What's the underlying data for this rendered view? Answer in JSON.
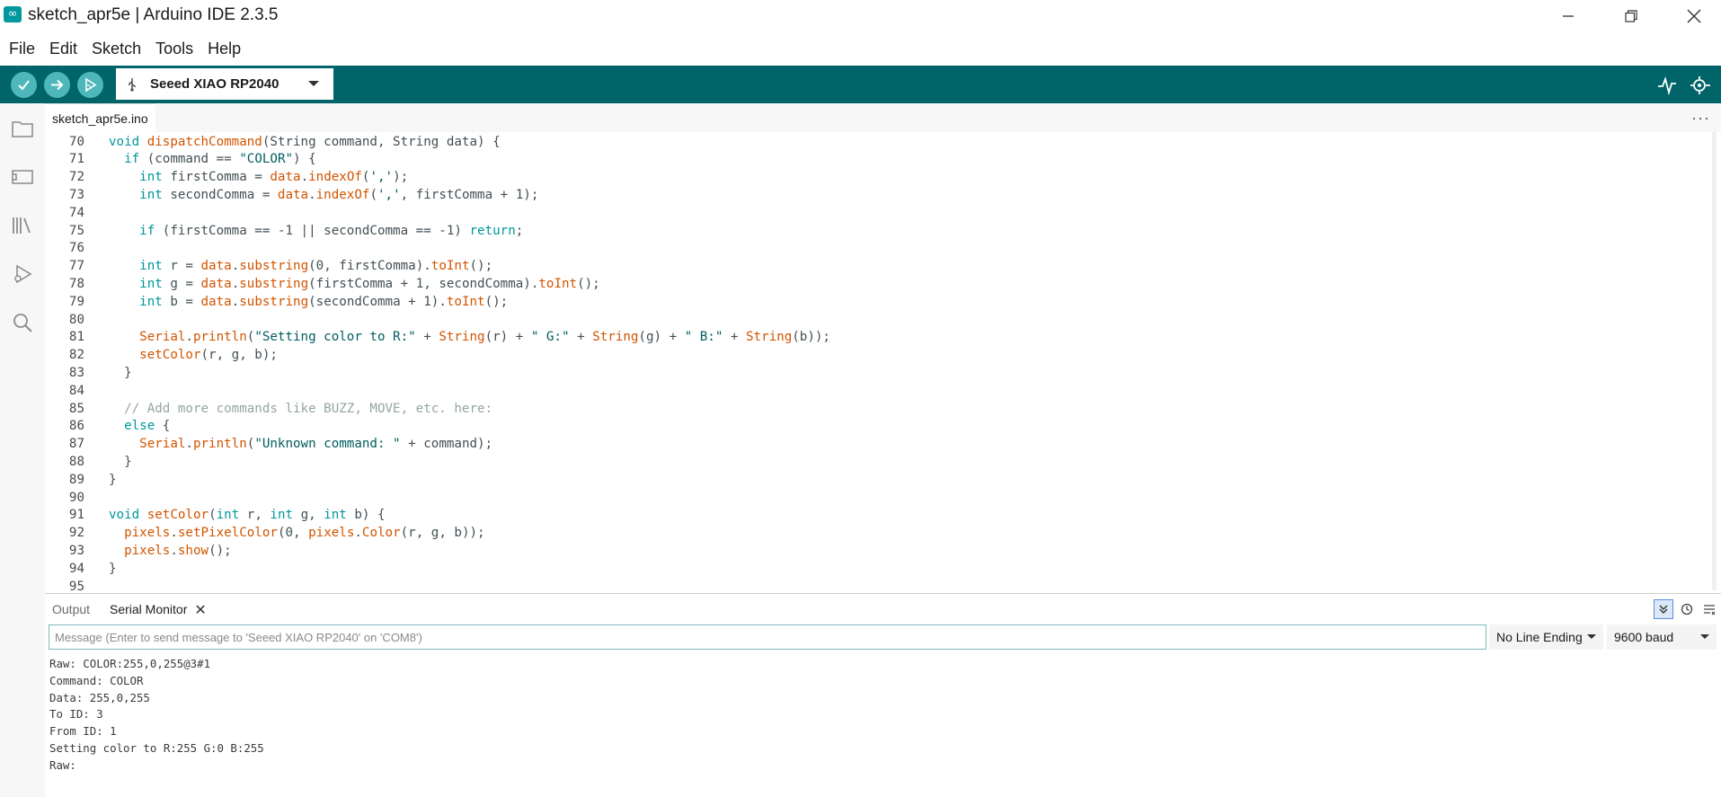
{
  "window": {
    "title": "sketch_apr5e | Arduino IDE 2.3.5",
    "minimize": "—",
    "maximize": "❐",
    "close": "✕"
  },
  "menu": [
    "File",
    "Edit",
    "Sketch",
    "Tools",
    "Help"
  ],
  "toolbar": {
    "board": "Seeed XIAO RP2040",
    "buttons": [
      "verify-icon",
      "upload-icon",
      "debug-icon"
    ],
    "right_icons": [
      "serial-plotter-icon",
      "serial-monitor-icon"
    ]
  },
  "activity": [
    "folder-icon",
    "boards-manager-icon",
    "library-manager-icon",
    "debug-icon",
    "search-icon"
  ],
  "editor": {
    "tab": "sketch_apr5e.ino",
    "more": "···",
    "lines": [
      {
        "n": "70",
        "segs": [
          [
            "kw",
            "void"
          ],
          [
            "",
            " "
          ],
          [
            "fn",
            "dispatchCommand"
          ],
          [
            "",
            "(String command, String data) {"
          ]
        ]
      },
      {
        "n": "71",
        "segs": [
          [
            "",
            "  "
          ],
          [
            "kw",
            "if"
          ],
          [
            "",
            " (command == "
          ],
          [
            "str",
            "\"COLOR\""
          ],
          [
            "",
            ") {"
          ]
        ]
      },
      {
        "n": "72",
        "segs": [
          [
            "",
            "    "
          ],
          [
            "kw",
            "int"
          ],
          [
            "",
            " firstComma = "
          ],
          [
            "fn",
            "data"
          ],
          [
            "",
            "."
          ],
          [
            "fn",
            "indexOf"
          ],
          [
            "",
            "("
          ],
          [
            "str",
            "','"
          ],
          [
            "",
            ");"
          ]
        ]
      },
      {
        "n": "73",
        "segs": [
          [
            "",
            "    "
          ],
          [
            "kw",
            "int"
          ],
          [
            "",
            " secondComma = "
          ],
          [
            "fn",
            "data"
          ],
          [
            "",
            "."
          ],
          [
            "fn",
            "indexOf"
          ],
          [
            "",
            "("
          ],
          [
            "str",
            "','"
          ],
          [
            "",
            ", firstComma + 1);"
          ]
        ]
      },
      {
        "n": "74",
        "segs": []
      },
      {
        "n": "75",
        "segs": [
          [
            "",
            "    "
          ],
          [
            "kw",
            "if"
          ],
          [
            "",
            " (firstComma == -1 || secondComma == -1) "
          ],
          [
            "kw",
            "return"
          ],
          [
            "",
            ";"
          ]
        ]
      },
      {
        "n": "76",
        "segs": []
      },
      {
        "n": "77",
        "segs": [
          [
            "",
            "    "
          ],
          [
            "kw",
            "int"
          ],
          [
            "",
            " r = "
          ],
          [
            "fn",
            "data"
          ],
          [
            "",
            "."
          ],
          [
            "fn",
            "substring"
          ],
          [
            "",
            "(0, firstComma)."
          ],
          [
            "fn",
            "toInt"
          ],
          [
            "",
            "();"
          ]
        ]
      },
      {
        "n": "78",
        "segs": [
          [
            "",
            "    "
          ],
          [
            "kw",
            "int"
          ],
          [
            "",
            " g = "
          ],
          [
            "fn",
            "data"
          ],
          [
            "",
            "."
          ],
          [
            "fn",
            "substring"
          ],
          [
            "",
            "(firstComma + 1, secondComma)."
          ],
          [
            "fn",
            "toInt"
          ],
          [
            "",
            "();"
          ]
        ]
      },
      {
        "n": "79",
        "segs": [
          [
            "",
            "    "
          ],
          [
            "kw",
            "int"
          ],
          [
            "",
            " b = "
          ],
          [
            "fn",
            "data"
          ],
          [
            "",
            "."
          ],
          [
            "fn",
            "substring"
          ],
          [
            "",
            "(secondComma + 1)."
          ],
          [
            "fn",
            "toInt"
          ],
          [
            "",
            "();"
          ]
        ]
      },
      {
        "n": "80",
        "segs": []
      },
      {
        "n": "81",
        "segs": [
          [
            "",
            "    "
          ],
          [
            "fn",
            "Serial"
          ],
          [
            "",
            "."
          ],
          [
            "fn",
            "println"
          ],
          [
            "",
            "("
          ],
          [
            "str",
            "\"Setting color to R:\""
          ],
          [
            "",
            " + "
          ],
          [
            "fn",
            "String"
          ],
          [
            "",
            "(r) + "
          ],
          [
            "str",
            "\" G:\""
          ],
          [
            "",
            " + "
          ],
          [
            "fn",
            "String"
          ],
          [
            "",
            "(g) + "
          ],
          [
            "str",
            "\" B:\""
          ],
          [
            "",
            " + "
          ],
          [
            "fn",
            "String"
          ],
          [
            "",
            "(b));"
          ]
        ]
      },
      {
        "n": "82",
        "segs": [
          [
            "",
            "    "
          ],
          [
            "fn",
            "setColor"
          ],
          [
            "",
            "(r, g, b);"
          ]
        ]
      },
      {
        "n": "83",
        "segs": [
          [
            "",
            "  }"
          ]
        ]
      },
      {
        "n": "84",
        "segs": []
      },
      {
        "n": "85",
        "segs": [
          [
            "",
            "  "
          ],
          [
            "cmt",
            "// Add more commands like BUZZ, MOVE, etc. here:"
          ]
        ]
      },
      {
        "n": "86",
        "segs": [
          [
            "",
            "  "
          ],
          [
            "kw",
            "else"
          ],
          [
            "",
            " {"
          ]
        ]
      },
      {
        "n": "87",
        "segs": [
          [
            "",
            "    "
          ],
          [
            "fn",
            "Serial"
          ],
          [
            "",
            "."
          ],
          [
            "fn",
            "println"
          ],
          [
            "",
            "("
          ],
          [
            "str",
            "\"Unknown command: \""
          ],
          [
            "",
            " + command);"
          ]
        ]
      },
      {
        "n": "88",
        "segs": [
          [
            "",
            "  }"
          ]
        ]
      },
      {
        "n": "89",
        "segs": [
          [
            "",
            "}"
          ]
        ]
      },
      {
        "n": "90",
        "segs": []
      },
      {
        "n": "91",
        "segs": [
          [
            "kw",
            "void"
          ],
          [
            "",
            " "
          ],
          [
            "fn",
            "setColor"
          ],
          [
            "",
            "("
          ],
          [
            "kw",
            "int"
          ],
          [
            "",
            " r, "
          ],
          [
            "kw",
            "int"
          ],
          [
            "",
            " g, "
          ],
          [
            "kw",
            "int"
          ],
          [
            "",
            " b) {"
          ]
        ]
      },
      {
        "n": "92",
        "segs": [
          [
            "",
            "  "
          ],
          [
            "fn",
            "pixels"
          ],
          [
            "",
            "."
          ],
          [
            "fn",
            "setPixelColor"
          ],
          [
            "",
            "(0, "
          ],
          [
            "fn",
            "pixels"
          ],
          [
            "",
            "."
          ],
          [
            "fn",
            "Color"
          ],
          [
            "",
            "(r, g, b));"
          ]
        ]
      },
      {
        "n": "93",
        "segs": [
          [
            "",
            "  "
          ],
          [
            "fn",
            "pixels"
          ],
          [
            "",
            "."
          ],
          [
            "fn",
            "show"
          ],
          [
            "",
            "();"
          ]
        ]
      },
      {
        "n": "94",
        "segs": [
          [
            "",
            "}"
          ]
        ]
      },
      {
        "n": "95",
        "segs": []
      }
    ]
  },
  "panel": {
    "tabs": [
      "Output",
      "Serial Monitor"
    ],
    "close": "✕",
    "message_placeholder": "Message (Enter to send message to 'Seeed XIAO RP2040' on 'COM8')",
    "line_ending": "No Line Ending",
    "baud": "9600 baud",
    "output": [
      "Raw: COLOR:255,0,255@3#1",
      "Command: COLOR",
      "Data: 255,0,255",
      "To ID: 3",
      "From ID: 1",
      "Setting color to R:255 G:0 B:255",
      "Raw: "
    ]
  },
  "colors": {
    "toolbar": "#006468",
    "button": "#4db7bb",
    "keyword": "#00979c",
    "function": "#d35400",
    "string": "#005c5f",
    "comment": "#95a5a6"
  }
}
